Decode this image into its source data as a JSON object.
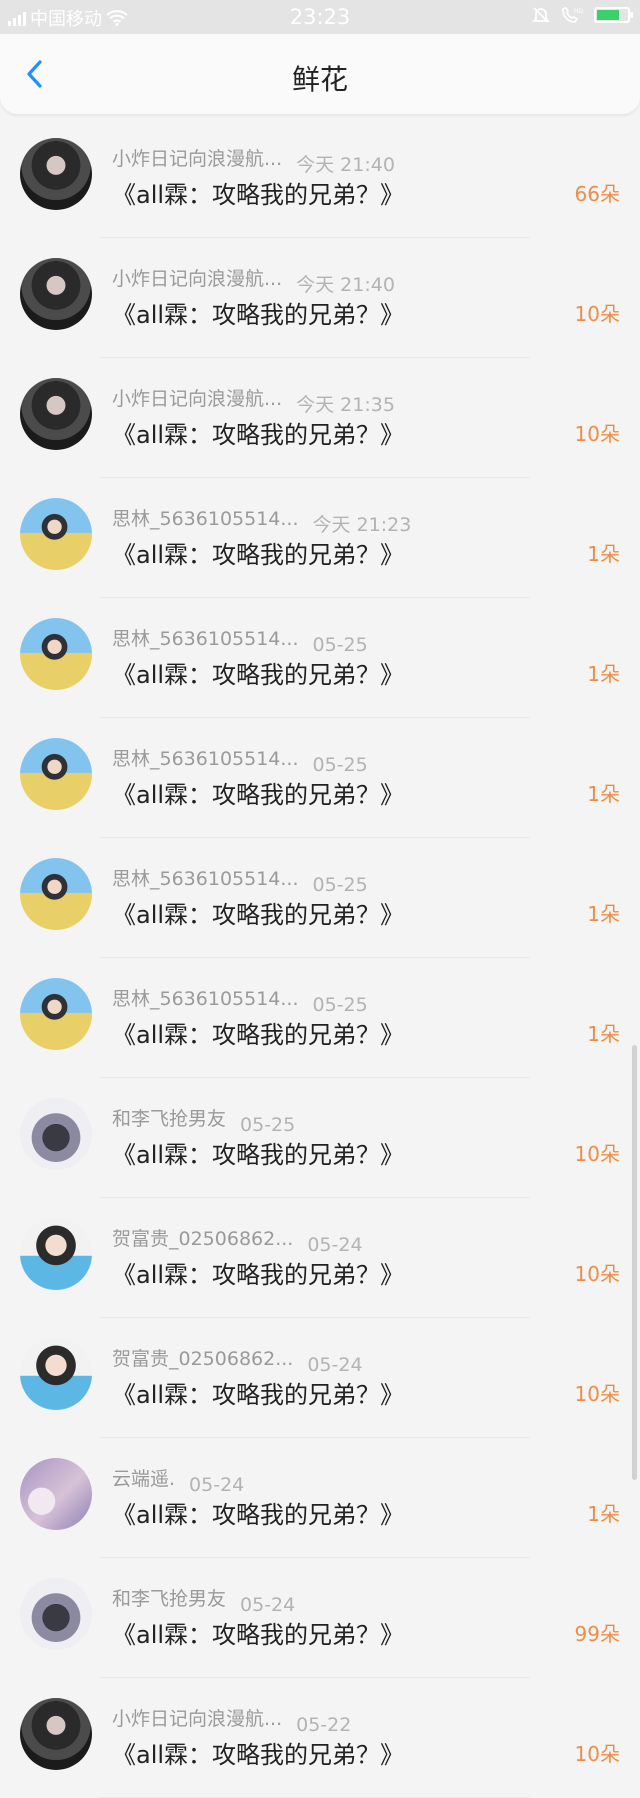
{
  "status_bar": {
    "carrier": "中国移动",
    "time": "23:23",
    "icons": [
      "signal-icon",
      "wifi-icon",
      "mute-icon",
      "hd-call-icon",
      "battery-icon"
    ]
  },
  "header": {
    "title": "鲜花",
    "back_icon": "chevron-left-icon"
  },
  "accent_color": "#1e90ff",
  "count_color": "#ee8d47",
  "items": [
    {
      "name": "小炸日记向浪漫航...",
      "time": "今天 21:40",
      "book": "《all霖：攻略我的兄弟？》",
      "count": "66朵",
      "avatar": "av-dark"
    },
    {
      "name": "小炸日记向浪漫航...",
      "time": "今天 21:40",
      "book": "《all霖：攻略我的兄弟？》",
      "count": "10朵",
      "avatar": "av-dark"
    },
    {
      "name": "小炸日记向浪漫航...",
      "time": "今天 21:35",
      "book": "《all霖：攻略我的兄弟？》",
      "count": "10朵",
      "avatar": "av-dark"
    },
    {
      "name": "思林_5636105514...",
      "time": "今天 21:23",
      "book": "《all霖：攻略我的兄弟？》",
      "count": "1朵",
      "avatar": "av-sky"
    },
    {
      "name": "思林_5636105514...",
      "time": "05-25",
      "book": "《all霖：攻略我的兄弟？》",
      "count": "1朵",
      "avatar": "av-sky"
    },
    {
      "name": "思林_5636105514...",
      "time": "05-25",
      "book": "《all霖：攻略我的兄弟？》",
      "count": "1朵",
      "avatar": "av-sky"
    },
    {
      "name": "思林_5636105514...",
      "time": "05-25",
      "book": "《all霖：攻略我的兄弟？》",
      "count": "1朵",
      "avatar": "av-sky"
    },
    {
      "name": "思林_5636105514...",
      "time": "05-25",
      "book": "《all霖：攻略我的兄弟？》",
      "count": "1朵",
      "avatar": "av-sky"
    },
    {
      "name": "和李飞抢男友",
      "time": "05-25",
      "book": "《all霖：攻略我的兄弟？》",
      "count": "10朵",
      "avatar": "av-group"
    },
    {
      "name": "贺富贵_02506862...",
      "time": "05-24",
      "book": "《all霖：攻略我的兄弟？》",
      "count": "10朵",
      "avatar": "av-boy"
    },
    {
      "name": "贺富贵_02506862...",
      "time": "05-24",
      "book": "《all霖：攻略我的兄弟？》",
      "count": "10朵",
      "avatar": "av-boy"
    },
    {
      "name": "云端遥.",
      "time": "05-24",
      "book": "《all霖：攻略我的兄弟？》",
      "count": "1朵",
      "avatar": "av-cloud"
    },
    {
      "name": "和李飞抢男友",
      "time": "05-24",
      "book": "《all霖：攻略我的兄弟？》",
      "count": "99朵",
      "avatar": "av-group"
    },
    {
      "name": "小炸日记向浪漫航...",
      "time": "05-22",
      "book": "《all霖：攻略我的兄弟？》",
      "count": "10朵",
      "avatar": "av-dark"
    }
  ]
}
